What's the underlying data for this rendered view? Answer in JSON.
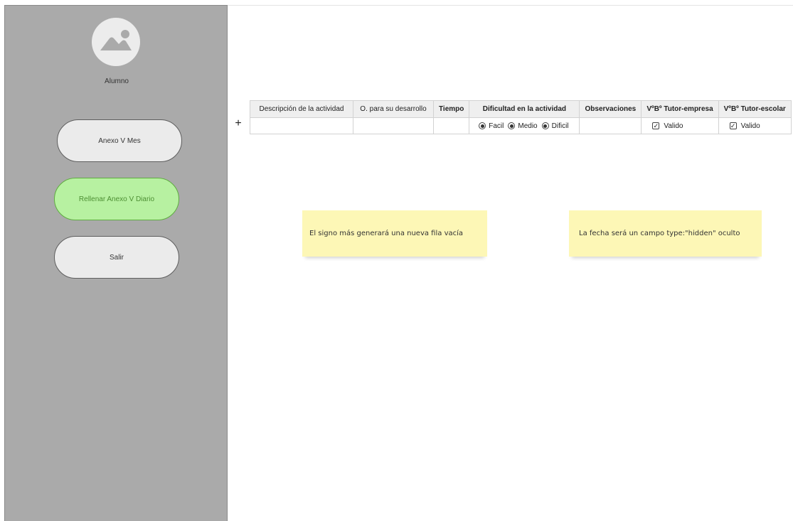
{
  "sidebar": {
    "avatar_icon": "image-placeholder-icon",
    "avatar_label": "Alumno",
    "buttons": [
      {
        "label": "Anexo V Mes"
      },
      {
        "label": "Rellenar Anexo V Diario",
        "active": true,
        "color": "#b7f1a1"
      },
      {
        "label": "Salir"
      }
    ]
  },
  "table": {
    "add_row_symbol": "+",
    "headers": [
      "Descripción de la actividad",
      "O. para su desarrollo",
      "Tiempo",
      "Dificultad en la actividad",
      "Observaciones",
      "VºBº Tutor-empresa",
      "VºBº Tutor-escolar"
    ],
    "row": {
      "descripcion": "",
      "desarrollo": "",
      "tiempo": "",
      "dificultad_options": [
        "Facil",
        "Medio",
        "Dificil"
      ],
      "observaciones": "",
      "tutor_empresa": "Valido",
      "tutor_escolar": "Valido",
      "check_symbol": "✓"
    }
  },
  "notes": [
    {
      "text": "El signo más  generará una nueva fila vacía",
      "color": "#fdf7b6"
    },
    {
      "text": "La fecha será un campo type:\"hidden\" oculto",
      "color": "#fdf7b6"
    }
  ]
}
